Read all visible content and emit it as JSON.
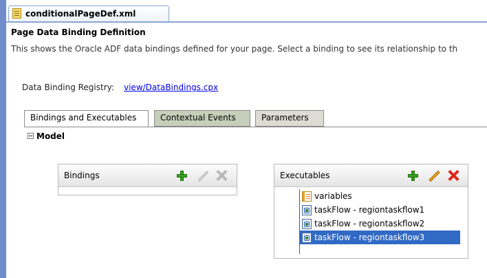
{
  "editor": {
    "file_tab_label": "conditionalPageDef.xml",
    "file_icon": "xml-file-icon"
  },
  "page": {
    "title": "Page Data Binding Definition",
    "description": "This shows the Oracle ADF data bindings defined for your page. Select a binding to see its relationship to th",
    "registry_label": "Data Binding Registry:",
    "registry_link": "view/DataBindings.cpx"
  },
  "tabs": [
    {
      "label": "Bindings and Executables",
      "active": true
    },
    {
      "label": "Contextual Events",
      "active": false
    },
    {
      "label": "Parameters",
      "active": false
    }
  ],
  "model": {
    "label": "Model",
    "expanded": true
  },
  "bindings_panel": {
    "title": "Bindings",
    "actions": {
      "add": "add-icon",
      "edit": "edit-icon",
      "delete": "delete-icon"
    },
    "actions_enabled": false,
    "items": []
  },
  "executables_panel": {
    "title": "Executables",
    "actions": {
      "add": "add-icon",
      "edit": "edit-icon",
      "delete": "delete-icon"
    },
    "actions_enabled": true,
    "items": [
      {
        "label": "variables",
        "icon": "variables-icon",
        "selected": false
      },
      {
        "label": "taskFlow - regiontaskflow1",
        "icon": "taskflow-icon",
        "selected": false
      },
      {
        "label": "taskFlow - regiontaskflow2",
        "icon": "taskflow-icon",
        "selected": false
      },
      {
        "label": "taskFlow - regiontaskflow3",
        "icon": "taskflow-icon",
        "selected": true
      }
    ]
  },
  "colors": {
    "accent_blue": "#6e8dc9",
    "selection": "#316ac5",
    "add_green": "#37a51f",
    "delete_red": "#e0251b",
    "edit_orange": "#f2a41c",
    "inactive_tab": "#c8d3bd"
  }
}
